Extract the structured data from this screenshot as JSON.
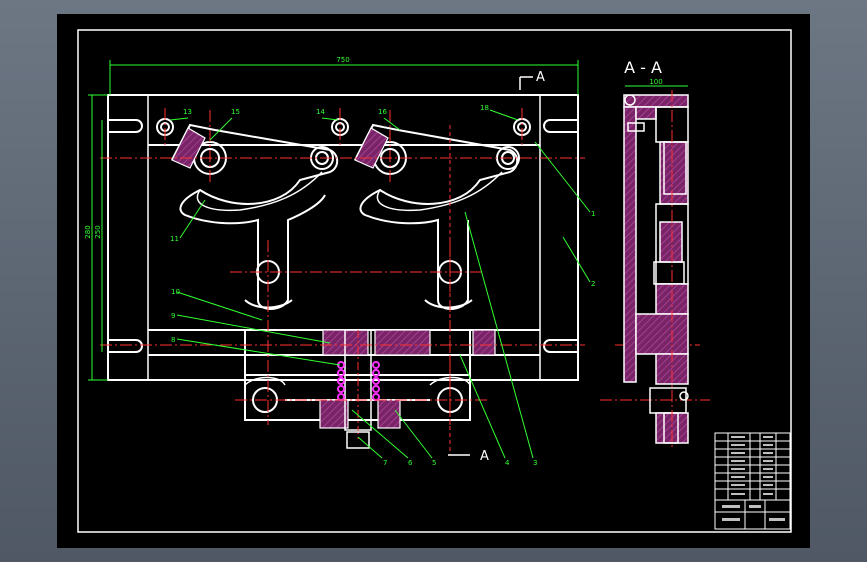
{
  "section_title": "A - A",
  "section_marker_top": "A",
  "section_marker_bottom": "A",
  "dimensions": {
    "overall_width": "750",
    "left_height_outer": "280",
    "left_height_inner": "250",
    "section_width": "100"
  },
  "part_numbers": {
    "p13": "13",
    "p15": "15",
    "p14": "14",
    "p16": "16",
    "p18": "18",
    "p1": "1",
    "p2": "2",
    "p3": "3",
    "p4": "4",
    "p5": "5",
    "p6": "6",
    "p7": "7",
    "p8": "8",
    "p9": "9",
    "p10": "10",
    "p11": "11"
  },
  "colors": {
    "background": "#000000",
    "line": "#ffffff",
    "centerline": "#ff3030",
    "dimension": "#30ff30",
    "hatch": "#8a2a7a",
    "spring": "#ff30ff"
  }
}
